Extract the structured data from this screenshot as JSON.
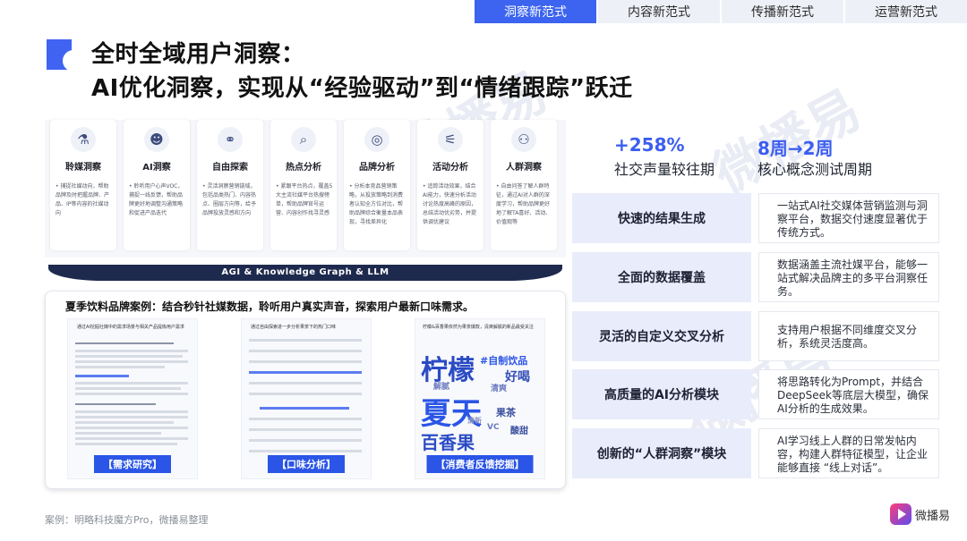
{
  "tabs": [
    {
      "label": "洞察新范式",
      "active": true
    },
    {
      "label": "内容新范式",
      "active": false
    },
    {
      "label": "传播新范式",
      "active": false
    },
    {
      "label": "运营新范式",
      "active": false
    }
  ],
  "title": {
    "line1": "全时全域用户洞察：",
    "line2": "AI优化洞察，实现从“经验驱动”到“情绪跟踪”跃迁"
  },
  "modules": [
    {
      "icon": "flask-icon",
      "glyph": "⚗",
      "title": "聆媒洞察",
      "desc": "• 捕捉社媒动向，帮助品牌及时把握品牌、产品、IP等内容的社媒动向"
    },
    {
      "icon": "ai-head-icon",
      "glyph": "☻",
      "title": "AI洞察",
      "desc": "• 聆听用户心声VOC，捕捉一线反馈，帮助品牌更好地调整沟通策略和促进产品迭代"
    },
    {
      "icon": "binoculars-icon",
      "glyph": "⚭",
      "title": "自由探索",
      "desc": "• 灵活洞察营销链域，包括品类热门、内容热点、圈层方向等，给予品牌投放灵感和方向"
    },
    {
      "icon": "search-icon",
      "glyph": "⌕",
      "title": "热点分析",
      "desc": "• 紧跟平台热点，覆盖5大主流社媒平台热搜榜单，帮助品牌官号运营、内容创作找寻灵感"
    },
    {
      "icon": "target-icon",
      "glyph": "◎",
      "title": "品牌分析",
      "desc": "• 分析本竞品营销策略，从投放策略到消费者认知全方位对比，帮助品牌综合衡量本品表现，寻找差异化"
    },
    {
      "icon": "chart-icon",
      "glyph": "⚟",
      "title": "活动分析",
      "desc": "• 追踪活动效果，结合AI能力，快速分析活动讨论热度高峰的原因，总结活动优劣势，并提供调优建议"
    },
    {
      "icon": "people-icon",
      "glyph": "⚇",
      "title": "人群洞察",
      "desc": "• 自由问答了解人群特征，通过AI对人群的深度学习，帮助品牌更好地了解TA喜好、活动、价值观等"
    }
  ],
  "agi_label": "AGI & Knowledge Graph & LLM",
  "case": {
    "title": "夏季饮料品牌案例：结合秒针社媒数据，聆听用户真实声音，探索用户最新口味需求。",
    "shots": [
      {
        "caption": "【需求研究】",
        "snippet": "通过AI挖掘社媒中的需求场景与相关产品提炼用户需求"
      },
      {
        "caption": "【口味分析】",
        "snippet": "通过自由探索进一步分析果茶下的热门口味"
      },
      {
        "caption": "【消费者反馈挖掘】",
        "snippet": "柠檬&百香果依然为果茶爆款，清爽解腻的新品最受关注"
      }
    ],
    "word_cloud": [
      "柠檬",
      "#自制饮品",
      "夏天",
      "好喝",
      "解腻",
      "百香果",
      "清爽",
      "果茶",
      "VC",
      "酸甜",
      "清新"
    ]
  },
  "stats": [
    {
      "value": "+258%",
      "label": "社交声量较往期"
    },
    {
      "value": "8周→2周",
      "label": "核心概念测试周期"
    }
  ],
  "features": [
    {
      "label": "快速的结果生成",
      "desc": "一站式AI社交媒体营销监测与洞察平台，数据交付速度显著优于传统方式。"
    },
    {
      "label": "全面的数据覆盖",
      "desc": "数据涵盖主流社媒平台，能够一站式解决品牌主的多平台洞察任务。"
    },
    {
      "label": "灵活的自定义交叉分析",
      "desc": "支持用户根据不同维度交叉分析，系统灵活度高。"
    },
    {
      "label": "高质量的AI分析模块",
      "desc": "将思路转化为Prompt，并结合DeepSeek等底层大模型，确保AI分析的生成效果。"
    },
    {
      "label": "创新的“人群洞察”模块",
      "desc": "AI学习线上人群的日常发帖内容，构建人群特征模型，让企业能够直接 “线上对话”。"
    }
  ],
  "source": "案例：明略科技魔方Pro，微播易整理",
  "brand": {
    "name": "微播易",
    "watermark": "微播易"
  },
  "colors": {
    "accent": "#3c5ef0",
    "tab_active": "#3c64f0",
    "feature_bg": "#e8ecfb",
    "agi_bar": "#1e2a4d"
  }
}
